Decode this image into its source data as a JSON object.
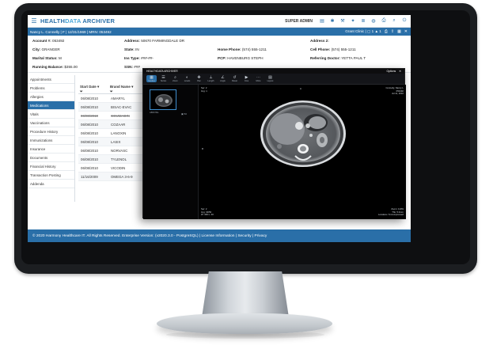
{
  "app": {
    "brand_1": "HEALTH",
    "brand_2": "DATA",
    "brand_3": " ARCHIVER",
    "user": "SUPER ADMIN"
  },
  "patient_bar": {
    "text": "Nancy L. Connelly  |  F  |  12/31/1969  |  MRN: 053492",
    "grant": "Grant Clinic",
    "grant_count": "1",
    "alerts": "1"
  },
  "demographics": {
    "account_label": "Account #:",
    "account_value": "053492",
    "city_label": "City:",
    "city_value": "GRANGER",
    "marital_label": "Marital Status:",
    "marital_value": "M",
    "balance_label": "Running Balance:",
    "balance_value": "$355.00",
    "address_label": "Address:",
    "address_value": "50670 FARMINGDALE DR",
    "state_label": "State:",
    "state_value": "IN",
    "ins_label": "Ins Type:",
    "ins_value": "###-##-",
    "ssn_label": "SSN:",
    "ssn_value": "###",
    "home_phone_label": "Home Phone:",
    "home_phone_value": "(574) 555-1211",
    "pcp_label": "PCP:",
    "pcp_value": "HAVENBURG STEPH",
    "address2_label": "Address 2:",
    "cell_label": "Cell Phone:",
    "cell_value": "(574) 555-1211",
    "ref_label": "Referring Doctor:",
    "ref_value": "YETTA PAUL T"
  },
  "sidebar": {
    "items": [
      {
        "label": "Appointments"
      },
      {
        "label": "Problems"
      },
      {
        "label": "Allergies"
      },
      {
        "label": "Medications"
      },
      {
        "label": "Vitals"
      },
      {
        "label": "Vaccinations"
      },
      {
        "label": "Procedure History"
      },
      {
        "label": "Immunizations"
      },
      {
        "label": "Insurance"
      },
      {
        "label": "Documents"
      },
      {
        "label": "Financial History"
      },
      {
        "label": "Transaction Posting"
      },
      {
        "label": "Addenda"
      }
    ],
    "active_index": 3
  },
  "medications": {
    "columns": [
      "Start Date",
      "Brand Name"
    ],
    "rows": [
      {
        "date": "06/08/2010",
        "name": "AMARYL",
        "struck": false
      },
      {
        "date": "06/08/2010",
        "name": "BISAC-EVAC",
        "struck": false
      },
      {
        "date": "06/08/2010",
        "name": "COUMADIN",
        "struck": true
      },
      {
        "date": "06/08/2010",
        "name": "COZAAR",
        "struck": false
      },
      {
        "date": "06/08/2010",
        "name": "LANOXIN",
        "struck": false
      },
      {
        "date": "06/08/2010",
        "name": "LASIX",
        "struck": false
      },
      {
        "date": "06/08/2010",
        "name": "NORVASC",
        "struck": false
      },
      {
        "date": "06/08/2010",
        "name": "TYLENOL",
        "struck": false
      },
      {
        "date": "06/08/2010",
        "name": "VICODIN",
        "struck": false
      },
      {
        "date": "11/16/2009",
        "name": "OMEGA 3-6-9",
        "struck": false
      }
    ]
  },
  "footer": {
    "text": "© 2020 Harmony Healthcare IT. All Rights Reserved. Enterprise Version: (v2020.3.0 - PostgreSQL) | License Information | Security | Privacy"
  },
  "viewer": {
    "title": "HEALTHDATA ARCHIVER",
    "top_right": "Options",
    "tools": [
      {
        "glyph": "▦",
        "label": "Studies",
        "icon": "studies-icon"
      },
      {
        "glyph": "☰",
        "label": "Series",
        "icon": "series-icon"
      },
      {
        "glyph": "⌕",
        "label": "Zoom",
        "icon": "zoom-icon"
      },
      {
        "glyph": "◐",
        "label": "Levels",
        "icon": "levels-icon"
      },
      {
        "glyph": "✥",
        "label": "Pan",
        "icon": "pan-icon"
      },
      {
        "glyph": "⟂",
        "label": "Length",
        "icon": "length-icon"
      },
      {
        "glyph": "∠",
        "label": "Angle",
        "icon": "angle-icon"
      },
      {
        "glyph": "↺",
        "label": "Reset",
        "icon": "reset-icon"
      },
      {
        "glyph": "▶",
        "label": "Cine",
        "icon": "cine-icon"
      },
      {
        "glyph": "⋯",
        "label": "More",
        "icon": "more-icon"
      },
      {
        "glyph": "▤",
        "label": "Layout",
        "icon": "layout-icon"
      }
    ],
    "thumb_label": "ABD PEL",
    "thumb_count": "50",
    "overlay_tl": "Ser: 2\nImg: 1",
    "overlay_tr": "Connelly, Nancy L\n053492\nJul 11, 2010",
    "overlay_bl": "Ser: 2\nImg: 30/50\nW: 400 L: 40",
    "overlay_br": "Zoom: 110%\nThk: 5.0mm\nLossless / Uncompressed",
    "overlay_top": "A",
    "overlay_left": "R"
  }
}
